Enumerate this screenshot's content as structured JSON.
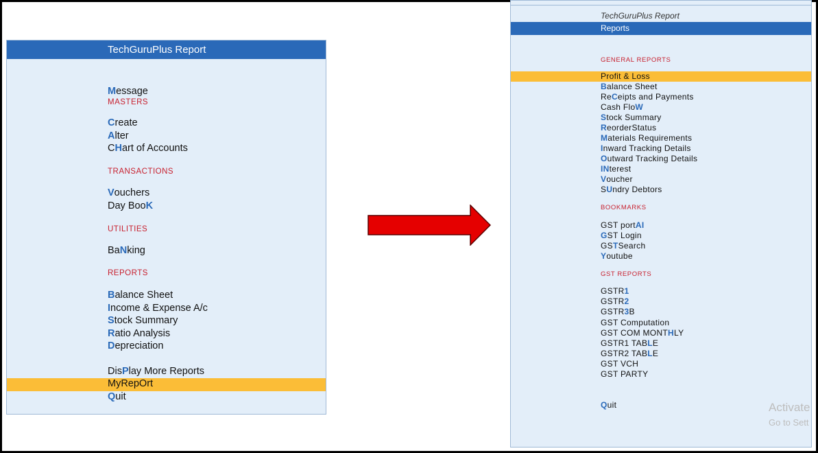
{
  "left": {
    "title": "TechGuruPlus Report",
    "items": [
      {
        "t": "Message",
        "pre": "",
        "hk": "M",
        "post": "essage",
        "kind": "item"
      },
      {
        "t": "MASTERS",
        "kind": "head"
      },
      {
        "pre": "",
        "hk": "C",
        "post": "reate",
        "kind": "item"
      },
      {
        "pre": "",
        "hk": "A",
        "post": "lter",
        "kind": "item"
      },
      {
        "pre": "C",
        "hk": "H",
        "post": "art of Accounts",
        "kind": "item"
      },
      {
        "t": "TRANSACTIONS",
        "kind": "head"
      },
      {
        "pre": "",
        "hk": "V",
        "post": "ouchers",
        "kind": "item"
      },
      {
        "pre": "Day Boo",
        "hk": "K",
        "post": "",
        "kind": "item"
      },
      {
        "t": "UTILITIES",
        "kind": "head"
      },
      {
        "pre": "Ba",
        "hk": "N",
        "post": "king",
        "kind": "item"
      },
      {
        "t": "REPORTS",
        "kind": "head"
      },
      {
        "pre": "",
        "hk": "B",
        "post": "alance Sheet",
        "kind": "item"
      },
      {
        "pre": "",
        "hk": "I",
        "post": "ncome & Expense A/c",
        "kind": "item"
      },
      {
        "pre": "",
        "hk": "S",
        "post": "tock Summary",
        "kind": "item"
      },
      {
        "pre": "",
        "hk": "R",
        "post": "atio Analysis",
        "kind": "item"
      },
      {
        "pre": "",
        "hk": "D",
        "post": "epreciation",
        "kind": "item"
      },
      {
        "pre": "Dis",
        "hk": "P",
        "post": "lay More Reports",
        "kind": "item"
      },
      {
        "pre": "MyRepOrt",
        "hk": "",
        "post": "",
        "kind": "item"
      },
      {
        "pre": "",
        "hk": "Q",
        "post": "uit",
        "kind": "item"
      }
    ]
  },
  "right": {
    "subtitle": "TechGuruPlus Report",
    "title": "Reports",
    "items": [
      {
        "t": "GENERAL REPORTS",
        "kind": "head"
      },
      {
        "pre": "P",
        "hk": "",
        "post": "rofit & Loss",
        "kind": "item"
      },
      {
        "pre": "",
        "hk": "B",
        "post": "alance Sheet",
        "kind": "item"
      },
      {
        "pre": "Re",
        "hk": "C",
        "post": "eipts and Payments",
        "kind": "item"
      },
      {
        "pre": "Cash Flo",
        "hk": "W",
        "post": "",
        "kind": "item"
      },
      {
        "pre": "",
        "hk": "S",
        "post": "tock Summary",
        "kind": "item"
      },
      {
        "pre": "",
        "hk": "R",
        "post": "eorderStatus",
        "kind": "item"
      },
      {
        "pre": "",
        "hk": "M",
        "post": "aterials Requirements",
        "kind": "item"
      },
      {
        "pre": "",
        "hk": "I",
        "post": "nward Tracking Details",
        "kind": "item"
      },
      {
        "pre": "",
        "hk": "O",
        "post": "utward Tracking Details",
        "kind": "item"
      },
      {
        "pre": "",
        "hk": "IN",
        "post": "terest",
        "kind": "item"
      },
      {
        "pre": "",
        "hk": "V",
        "post": "oucher",
        "kind": "item"
      },
      {
        "pre": "S",
        "hk": "U",
        "post": "ndry Debtors",
        "kind": "item"
      },
      {
        "t": "BOOKMARKS",
        "kind": "head"
      },
      {
        "pre": "GST port",
        "hk": "AI",
        "post": "",
        "kind": "item"
      },
      {
        "pre": "",
        "hk": "G",
        "post": "ST Login",
        "kind": "item"
      },
      {
        "pre": "GS",
        "hk": "T",
        "post": "Search",
        "kind": "item"
      },
      {
        "pre": "",
        "hk": "Y",
        "post": "outube",
        "kind": "item"
      },
      {
        "t": "GST REPORTS",
        "kind": "head"
      },
      {
        "pre": "GSTR",
        "hk": "1",
        "post": "",
        "kind": "item"
      },
      {
        "pre": "GSTR",
        "hk": "2",
        "post": "",
        "kind": "item"
      },
      {
        "pre": "GSTR",
        "hk": "3",
        "post": "B",
        "kind": "item"
      },
      {
        "pre": "GST Computation",
        "hk": "",
        "post": "",
        "kind": "item"
      },
      {
        "pre": "GST COM MONT",
        "hk": "H",
        "post": "LY",
        "kind": "item"
      },
      {
        "pre": "GSTR1 TAB",
        "hk": "L",
        "post": "E",
        "kind": "item"
      },
      {
        "pre": "GSTR2 TAB",
        "hk": "L",
        "post": "E",
        "kind": "item"
      },
      {
        "pre": "GST VCH",
        "hk": "",
        "post": "",
        "kind": "item"
      },
      {
        "pre": "GST PARTY",
        "hk": "",
        "post": "",
        "kind": "item"
      },
      {
        "pre": "",
        "hk": "Q",
        "post": "uit",
        "kind": "item"
      }
    ]
  },
  "watermark": {
    "line1": "Activate",
    "line2": "Go to Sett"
  },
  "colors": {
    "title_bar": "#2a69b8",
    "highlight": "#fbbd37",
    "section_heading": "#c8202e",
    "hotkey": "#2a69b8",
    "arrow": "#e50000"
  }
}
